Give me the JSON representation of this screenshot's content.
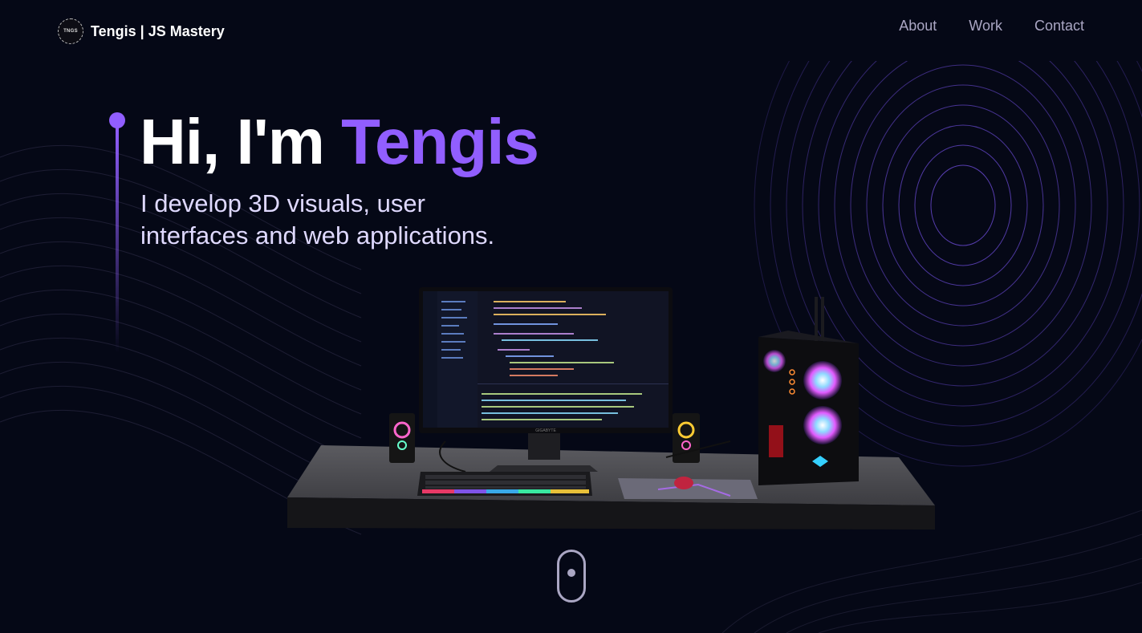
{
  "header": {
    "logo_text": "TNGS",
    "brand": "Tengis | JS Mastery",
    "nav": [
      {
        "label": "About"
      },
      {
        "label": "Work"
      },
      {
        "label": "Contact"
      }
    ]
  },
  "hero": {
    "greeting": "Hi, I'm ",
    "name": "Tengis",
    "subtitle_line1": "I develop 3D visuals, user",
    "subtitle_line2": "interfaces and web applications."
  },
  "scene": {
    "monitor_brand": "GIGABYTE"
  },
  "icons": {
    "logo": "circle-badge-icon",
    "scroll": "mouse-scroll-icon"
  },
  "colors": {
    "background": "#050816",
    "accent": "#915eff",
    "nav_text": "#aaa6c3",
    "subtitle_text": "#dfd9ff"
  }
}
